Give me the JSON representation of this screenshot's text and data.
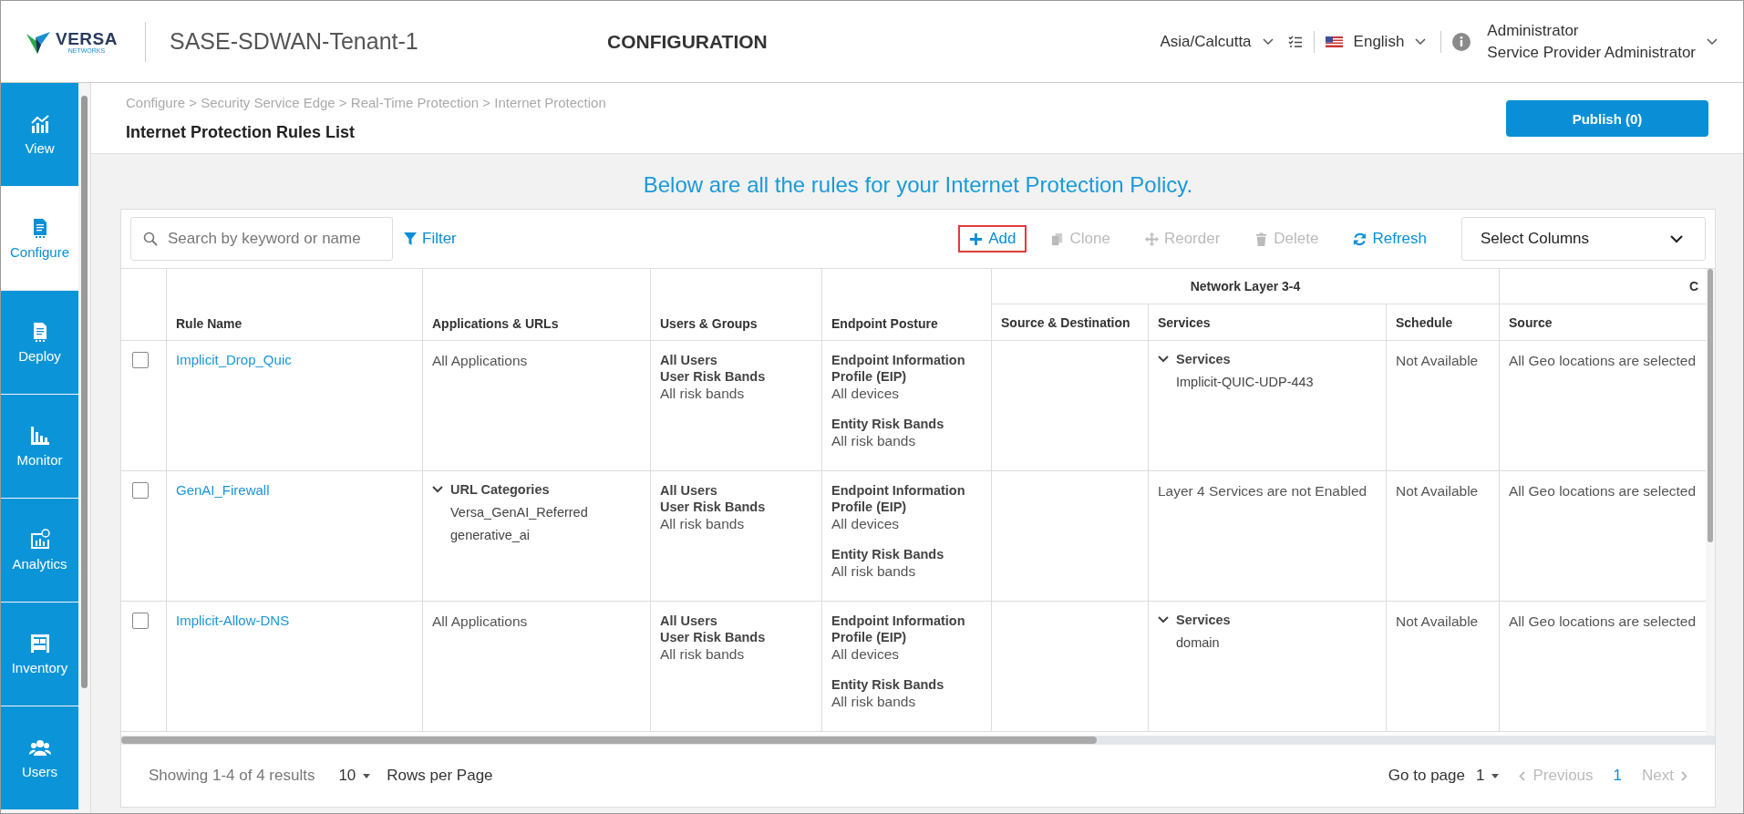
{
  "header": {
    "logo": {
      "name": "VERSA",
      "sub": "NETWORKS"
    },
    "tenant": "SASE-SDWAN-Tenant-1",
    "title": "CONFIGURATION",
    "timezone": "Asia/Calcutta",
    "language": "English",
    "user": {
      "name": "Administrator",
      "role": "Service Provider Administrator"
    }
  },
  "sidebar": {
    "items": [
      {
        "label": "View",
        "selected": false
      },
      {
        "label": "Configure",
        "selected": true
      },
      {
        "label": "Deploy",
        "selected": false
      },
      {
        "label": "Monitor",
        "selected": false
      },
      {
        "label": "Analytics",
        "selected": false
      },
      {
        "label": "Inventory",
        "selected": false
      },
      {
        "label": "Users",
        "selected": false
      }
    ]
  },
  "breadcrumb": "Configure > Security Service Edge > Real-Time Protection > Internet Protection",
  "page_title": "Internet Protection Rules List",
  "publish_button": "Publish (0)",
  "intro": "Below are all the rules for your Internet Protection Policy.",
  "toolbar": {
    "search": {
      "placeholder": "Search by keyword or name"
    },
    "filter": "Filter",
    "actions": [
      {
        "label": "Add",
        "disabled": false,
        "highlighted": true
      },
      {
        "label": "Clone",
        "disabled": true,
        "highlighted": false
      },
      {
        "label": "Reorder",
        "disabled": true,
        "highlighted": false
      },
      {
        "label": "Delete",
        "disabled": true,
        "highlighted": false
      },
      {
        "label": "Refresh",
        "disabled": false,
        "highlighted": false
      }
    ],
    "select_columns": "Select Columns"
  },
  "table": {
    "group_headers": [
      "Network Layer 3-4",
      "C"
    ],
    "columns": [
      "Rule Name",
      "Applications & URLs",
      "Users & Groups",
      "Endpoint Posture",
      "Source & Destination",
      "Services",
      "Schedule",
      "Source"
    ],
    "rows": [
      {
        "checked": false,
        "name": "Implicit_Drop_Quic",
        "apps": [
          {
            "kind": "value",
            "text": "All Applications"
          }
        ],
        "users": [
          {
            "kind": "label",
            "text": "All Users"
          },
          {
            "kind": "label",
            "text": "User Risk Bands"
          },
          {
            "kind": "value",
            "text": "All risk bands"
          }
        ],
        "endpoint": [
          {
            "kind": "label",
            "text": "Endpoint Information Profile (EIP)"
          },
          {
            "kind": "value",
            "text": "All devices"
          },
          {
            "kind": "gap"
          },
          {
            "kind": "label",
            "text": "Entity Risk Bands"
          },
          {
            "kind": "value",
            "text": "All risk bands"
          }
        ],
        "src_dst": [],
        "services": [
          {
            "kind": "group",
            "title": "Services",
            "expanded": true,
            "items": [
              "Implicit-QUIC-UDP-443"
            ]
          }
        ],
        "schedule": [
          {
            "kind": "value",
            "text": "Not Available"
          }
        ],
        "source": [
          {
            "kind": "value",
            "text": "All Geo locations are selected"
          }
        ]
      },
      {
        "checked": false,
        "name": "GenAI_Firewall",
        "apps": [
          {
            "kind": "group",
            "title": "URL Categories",
            "expanded": true,
            "items": [
              "Versa_GenAI_Referred",
              "generative_ai"
            ]
          }
        ],
        "users": [
          {
            "kind": "label",
            "text": "All Users"
          },
          {
            "kind": "label",
            "text": "User Risk Bands"
          },
          {
            "kind": "value",
            "text": "All risk bands"
          }
        ],
        "endpoint": [
          {
            "kind": "label",
            "text": "Endpoint Information Profile (EIP)"
          },
          {
            "kind": "value",
            "text": "All devices"
          },
          {
            "kind": "gap"
          },
          {
            "kind": "label",
            "text": "Entity Risk Bands"
          },
          {
            "kind": "value",
            "text": "All risk bands"
          }
        ],
        "src_dst": [],
        "services": [
          {
            "kind": "value",
            "text": "Layer 4 Services are not Enabled"
          }
        ],
        "schedule": [
          {
            "kind": "value",
            "text": "Not Available"
          }
        ],
        "source": [
          {
            "kind": "value",
            "text": "All Geo locations are selected"
          }
        ]
      },
      {
        "checked": false,
        "name": "Implicit-Allow-DNS",
        "apps": [
          {
            "kind": "value",
            "text": "All Applications"
          }
        ],
        "users": [
          {
            "kind": "label",
            "text": "All Users"
          },
          {
            "kind": "label",
            "text": "User Risk Bands"
          },
          {
            "kind": "value",
            "text": "All risk bands"
          }
        ],
        "endpoint": [
          {
            "kind": "label",
            "text": "Endpoint Information Profile (EIP)"
          },
          {
            "kind": "value",
            "text": "All devices"
          },
          {
            "kind": "gap"
          },
          {
            "kind": "label",
            "text": "Entity Risk Bands"
          },
          {
            "kind": "value",
            "text": "All risk bands"
          }
        ],
        "src_dst": [],
        "services": [
          {
            "kind": "group",
            "title": "Services",
            "expanded": true,
            "items": [
              "domain"
            ]
          }
        ],
        "schedule": [
          {
            "kind": "value",
            "text": "Not Available"
          }
        ],
        "source": [
          {
            "kind": "value",
            "text": "All Geo locations are selected"
          }
        ]
      }
    ]
  },
  "footer": {
    "showing": "Showing 1-4 of 4 results",
    "rows_per_page_value": "10",
    "rows_per_page": "Rows per Page",
    "go_to_page": "Go to page",
    "page_value": "1",
    "previous": {
      "label": "Previous",
      "disabled": true
    },
    "pages": [
      {
        "label": "1",
        "selected": true
      }
    ],
    "next": {
      "label": "Next",
      "disabled": true
    }
  }
}
